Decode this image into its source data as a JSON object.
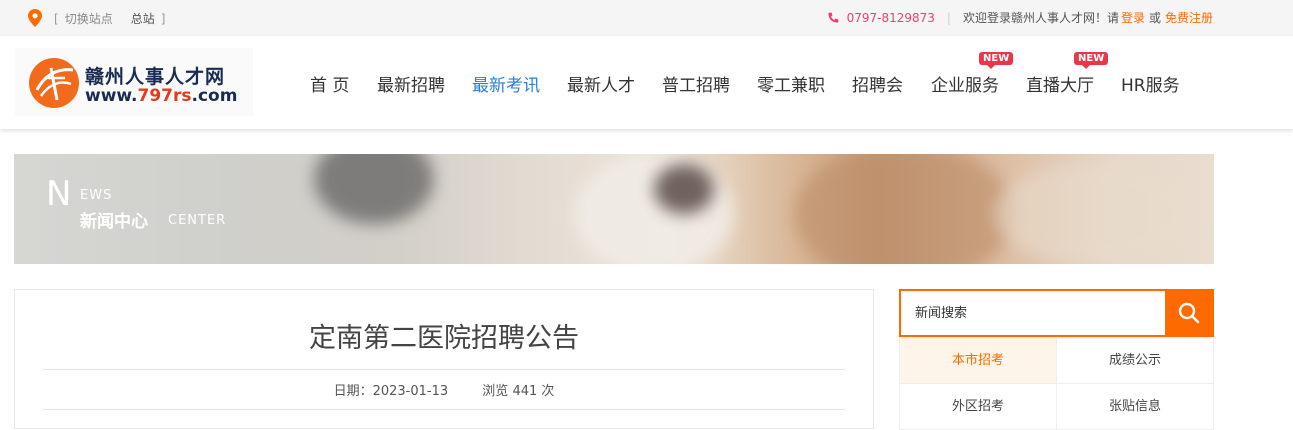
{
  "topbar": {
    "icon": "location-pin-icon",
    "bracket_open": "[",
    "switch_label": "切换站点",
    "current_site": "总站",
    "bracket_close": "]",
    "phone_icon": "phone-icon",
    "phone": "0797-8129873",
    "separator": "|",
    "welcome": "欢迎登录赣州人事人才网！请",
    "login": "登录",
    "or": "或",
    "register": "免费注册"
  },
  "logo": {
    "name": "赣州人事人才网",
    "url_prefix": "www.",
    "url_highlight": "797rs",
    "url_suffix": ".com"
  },
  "nav": {
    "items": [
      {
        "label": "首 页"
      },
      {
        "label": "最新招聘"
      },
      {
        "label": "最新考讯",
        "active": true
      },
      {
        "label": "最新人才"
      },
      {
        "label": "普工招聘"
      },
      {
        "label": "零工兼职"
      },
      {
        "label": "招聘会"
      },
      {
        "label": "企业服务",
        "badge": "NEW"
      },
      {
        "label": "直播大厅",
        "badge": "NEW"
      },
      {
        "label": "HR服务"
      }
    ]
  },
  "banner": {
    "n_letter": "N",
    "ews": "EWS",
    "cn_title": "新闻中心",
    "center": "CENTER"
  },
  "article": {
    "title": "定南第二医院招聘公告",
    "date_label": "日期：",
    "date": "2023-01-13",
    "views_label": "浏览",
    "views": "441",
    "views_unit": "次"
  },
  "sidebar": {
    "search_placeholder": "新闻搜索",
    "search_icon": "search-icon",
    "tabs": [
      {
        "label": "本市招考",
        "active": true
      },
      {
        "label": "成绩公示"
      },
      {
        "label": "外区招考"
      },
      {
        "label": "张贴信息"
      }
    ]
  },
  "colors": {
    "accent": "#ff6a00",
    "nav_active": "#2a7fd6",
    "phone": "#e8436b",
    "badge": "#e8374a"
  }
}
